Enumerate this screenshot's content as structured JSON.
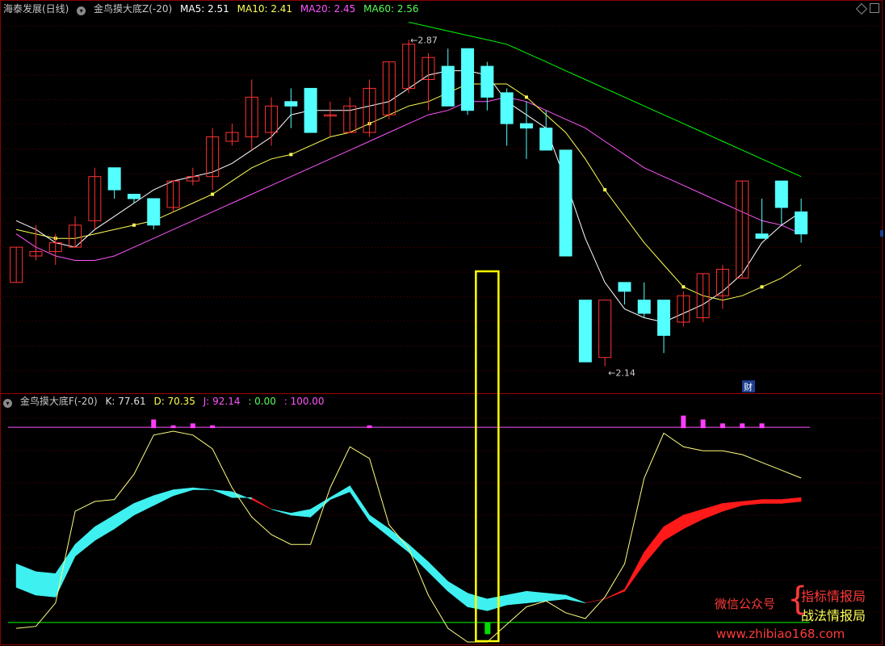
{
  "header_main": {
    "stock": "海泰发展(日线)",
    "indicator": "金鸟摸大底Z(-20)",
    "ma5": "MA5: 2.51",
    "ma10": "MA10: 2.41",
    "ma20": "MA20: 2.45",
    "ma60": "MA60: 2.56"
  },
  "header_sub": {
    "indicator": "金鸟摸大底F(-20)",
    "k": "K: 77.61",
    "d": "D: 70.35",
    "j": "J: 92.14",
    "v0": ": 0.00",
    "v100": ": 100.00"
  },
  "annotations": {
    "high": "2.87",
    "low": "2.14",
    "cai": "财"
  },
  "watermark": {
    "wechat": "微信公众号",
    "line1": "指标情报局",
    "line2": "战法情报局",
    "url": "www.zhibiao168.com"
  },
  "colors": {
    "up": "#ff3232",
    "down": "#54ffff",
    "ma5": "#ffffff",
    "ma10": "#ffff54",
    "ma20": "#ff54ff",
    "ma60": "#00ff00",
    "highlight": "#ffff00"
  },
  "chart_data": [
    {
      "type": "candlestick",
      "name": "main",
      "x": [
        1,
        2,
        3,
        4,
        5,
        6,
        7,
        8,
        9,
        10,
        11,
        12,
        13,
        14,
        15,
        16,
        17,
        18,
        19,
        20,
        21,
        22,
        23,
        24,
        25,
        26,
        27,
        28,
        29,
        30,
        31,
        32,
        33,
        34,
        35,
        36,
        37,
        38,
        39,
        40,
        41
      ],
      "open": [
        2.32,
        2.38,
        2.39,
        2.4,
        2.46,
        2.58,
        2.52,
        2.51,
        2.49,
        2.55,
        2.56,
        2.64,
        2.65,
        2.66,
        2.73,
        2.76,
        2.7,
        2.66,
        2.66,
        2.7,
        2.76,
        2.78,
        2.81,
        2.85,
        2.81,
        2.75,
        2.68,
        2.67,
        2.62,
        2.28,
        2.15,
        2.32,
        2.28,
        2.28,
        2.23,
        2.24,
        2.29,
        2.33,
        2.43,
        2.55,
        2.48
      ],
      "close": [
        2.4,
        2.39,
        2.41,
        2.45,
        2.56,
        2.53,
        2.51,
        2.45,
        2.55,
        2.56,
        2.65,
        2.66,
        2.74,
        2.72,
        2.72,
        2.66,
        2.7,
        2.72,
        2.76,
        2.82,
        2.86,
        2.83,
        2.72,
        2.71,
        2.74,
        2.68,
        2.67,
        2.62,
        2.38,
        2.14,
        2.28,
        2.3,
        2.25,
        2.2,
        2.29,
        2.34,
        2.35,
        2.55,
        2.42,
        2.49,
        2.43
      ],
      "high": [
        2.4,
        2.45,
        2.43,
        2.47,
        2.58,
        2.58,
        2.52,
        2.51,
        2.55,
        2.58,
        2.67,
        2.68,
        2.78,
        2.74,
        2.76,
        2.76,
        2.73,
        2.74,
        2.78,
        2.82,
        2.87,
        2.84,
        2.85,
        2.85,
        2.82,
        2.76,
        2.73,
        2.71,
        2.62,
        2.28,
        2.15,
        2.32,
        2.32,
        2.28,
        2.3,
        2.34,
        2.36,
        2.55,
        2.51,
        2.55,
        2.51
      ],
      "low": [
        2.32,
        2.37,
        2.36,
        2.4,
        2.44,
        2.51,
        2.5,
        2.44,
        2.48,
        2.54,
        2.53,
        2.63,
        2.62,
        2.63,
        2.67,
        2.66,
        2.65,
        2.66,
        2.65,
        2.69,
        2.75,
        2.71,
        2.72,
        2.7,
        2.71,
        2.63,
        2.6,
        2.62,
        2.38,
        2.14,
        2.13,
        2.27,
        2.24,
        2.16,
        2.22,
        2.23,
        2.26,
        2.33,
        2.42,
        2.45,
        2.41
      ],
      "ma5": [
        2.46,
        2.44,
        2.41,
        2.4,
        2.44,
        2.47,
        2.5,
        2.53,
        2.55,
        2.56,
        2.57,
        2.59,
        2.62,
        2.65,
        2.7,
        2.71,
        2.71,
        2.71,
        2.72,
        2.73,
        2.76,
        2.79,
        2.8,
        2.8,
        2.79,
        2.73,
        2.7,
        2.67,
        2.55,
        2.42,
        2.32,
        2.26,
        2.24,
        2.23,
        2.25,
        2.27,
        2.3,
        2.34,
        2.41,
        2.45,
        2.48
      ],
      "ma10": [
        2.44,
        2.43,
        2.42,
        2.42,
        2.43,
        2.44,
        2.45,
        2.46,
        2.48,
        2.5,
        2.52,
        2.55,
        2.58,
        2.6,
        2.61,
        2.63,
        2.65,
        2.66,
        2.68,
        2.7,
        2.72,
        2.73,
        2.75,
        2.77,
        2.77,
        2.77,
        2.74,
        2.7,
        2.66,
        2.6,
        2.53,
        2.47,
        2.41,
        2.36,
        2.31,
        2.29,
        2.28,
        2.29,
        2.31,
        2.33,
        2.36
      ],
      "ma20": [
        2.43,
        2.4,
        2.38,
        2.37,
        2.37,
        2.38,
        2.4,
        2.42,
        2.44,
        2.46,
        2.48,
        2.5,
        2.52,
        2.54,
        2.56,
        2.58,
        2.6,
        2.62,
        2.64,
        2.66,
        2.68,
        2.7,
        2.71,
        2.73,
        2.73,
        2.74,
        2.73,
        2.71,
        2.69,
        2.67,
        2.64,
        2.61,
        2.58,
        2.56,
        2.54,
        2.52,
        2.5,
        2.48,
        2.46,
        2.45,
        2.43
      ],
      "ma60": [
        null,
        null,
        null,
        null,
        null,
        null,
        null,
        null,
        null,
        null,
        null,
        null,
        null,
        null,
        null,
        null,
        null,
        null,
        null,
        null,
        2.91,
        2.9,
        2.89,
        2.88,
        2.87,
        2.86,
        2.84,
        2.82,
        2.8,
        2.78,
        2.76,
        2.74,
        2.72,
        2.7,
        2.68,
        2.66,
        2.64,
        2.62,
        2.6,
        2.58,
        2.56
      ],
      "ylim": [
        2.1,
        2.92
      ]
    },
    {
      "type": "line",
      "name": "sub",
      "x": [
        1,
        2,
        3,
        4,
        5,
        6,
        7,
        8,
        9,
        10,
        11,
        12,
        13,
        14,
        15,
        16,
        17,
        18,
        19,
        20,
        21,
        22,
        23,
        24,
        25,
        26,
        27,
        28,
        29,
        30,
        31,
        32,
        33,
        34,
        35,
        36,
        37,
        38,
        39,
        40,
        41
      ],
      "ylim": [
        -10,
        110
      ],
      "levels": [
        0,
        100
      ],
      "ribbon_k": [
        18,
        14,
        13,
        34,
        42,
        48,
        55,
        60,
        65,
        68,
        68,
        64,
        64,
        58,
        55,
        54,
        63,
        67,
        52,
        44,
        36,
        26,
        16,
        8,
        6,
        9,
        10,
        11,
        12,
        10,
        12,
        17,
        36,
        49,
        55,
        58,
        61,
        62,
        63,
        63,
        64
      ],
      "ribbon_d": [
        30,
        26,
        25,
        40,
        49,
        55,
        61,
        65,
        68,
        69,
        68,
        67,
        63,
        58,
        56,
        58,
        64,
        70,
        55,
        48,
        40,
        31,
        21,
        15,
        12,
        14,
        16,
        15,
        14,
        10,
        12,
        16,
        30,
        42,
        48,
        53,
        57,
        60,
        61,
        61,
        62
      ],
      "j": [
        -3,
        -2,
        10,
        57,
        62,
        63,
        76,
        96,
        98,
        96,
        89,
        69,
        54,
        45,
        40,
        40,
        69,
        90,
        84,
        50,
        38,
        14,
        -3,
        -10,
        -10,
        -1,
        8,
        11,
        5,
        2,
        13,
        30,
        74,
        97,
        90,
        88,
        88,
        86,
        82,
        78,
        74
      ],
      "bars_magenta": [
        0,
        0,
        0,
        0,
        0,
        0,
        0,
        104,
        101,
        102,
        101,
        0,
        0,
        0,
        0,
        0,
        0,
        0,
        101,
        0,
        0,
        0,
        0,
        0,
        0,
        0,
        0,
        0,
        0,
        0,
        0,
        0,
        0,
        0,
        106,
        104,
        102,
        102,
        102,
        0,
        0
      ],
      "bar_green": {
        "x": 25,
        "value": -6
      }
    }
  ]
}
